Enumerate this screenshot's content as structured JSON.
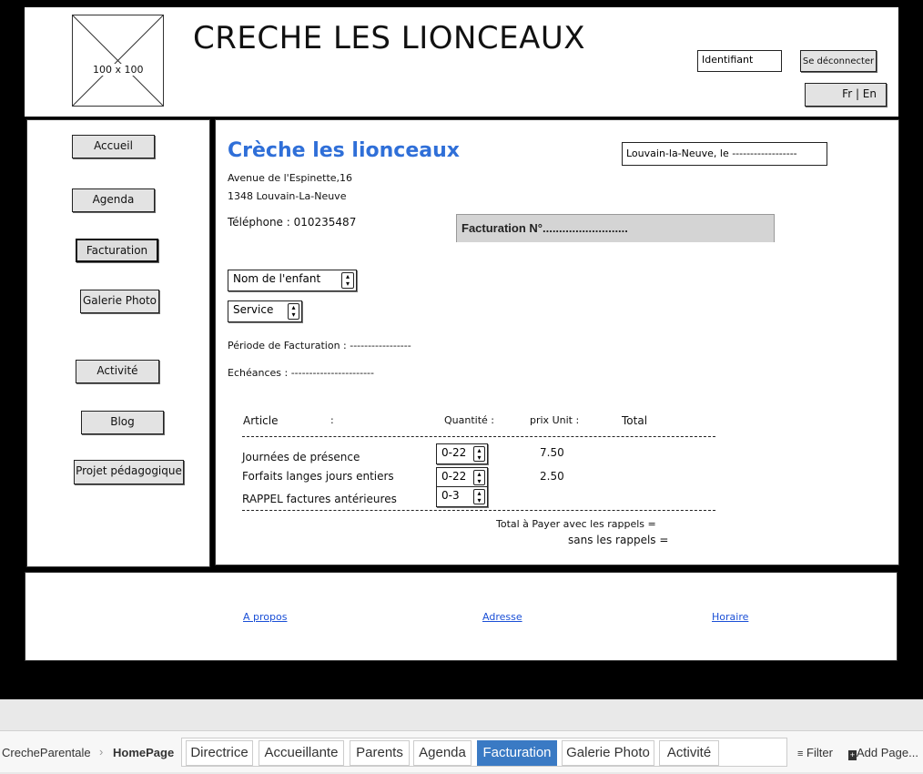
{
  "header": {
    "logo_placeholder": "100 x 100",
    "title": "CRECHE LES LIONCEAUX",
    "login_field": "Identifiant",
    "logout_button": "Se déconnecter",
    "lang_button": "Fr | En"
  },
  "sidebar": {
    "items": [
      {
        "label": "Accueil"
      },
      {
        "label": "Agenda"
      },
      {
        "label": "Facturation"
      },
      {
        "label": "Galerie Photo"
      },
      {
        "label": "Activité"
      },
      {
        "label": "Blog"
      },
      {
        "label": "Projet pédagogique"
      }
    ]
  },
  "invoice": {
    "org_name": "Crèche les lionceaux",
    "address_line1": "Avenue de l'Espinette,16",
    "address_line2": "1348 Louvain-La-Neuve",
    "phone": "Téléphone : 010235487",
    "place_date": "Louvain-la-Neuve, le ------------------",
    "invoice_number": "Facturation N°..........................",
    "child_select": "Nom de l'enfant",
    "service_select": "Service",
    "period": "Période de Facturation : -----------------",
    "due_dates": "Echéances : -----------------------",
    "columns": {
      "article": "Article",
      "colon": ":",
      "quantity": "Quantité :",
      "unit_price": "prix Unit :",
      "total": "Total"
    },
    "rows": [
      {
        "article": "Journées de présence",
        "qty": "0-22",
        "price": "7.50"
      },
      {
        "article": "Forfaits langes jours entiers",
        "qty": "0-22",
        "price": "2.50"
      },
      {
        "article": "RAPPEL factures antérieures",
        "qty": "0-3",
        "price": ""
      }
    ],
    "total_with": "Total à Payer avec les rappels =",
    "total_without": "sans les rappels ="
  },
  "footer": {
    "links": [
      "A propos",
      "Adresse",
      "Horaire"
    ]
  },
  "bottom_bar": {
    "breadcrumb_root": "CrecheParentale",
    "breadcrumb_sep": "›",
    "breadcrumb_current": "HomePage",
    "tabs": [
      "Directrice",
      "Accueillante",
      "Parents",
      "Agenda",
      "Facturation",
      "Galerie Photo",
      "Activité"
    ],
    "selected_tab": "Facturation",
    "filter": "Filter",
    "add_page": "Add Page..."
  },
  "colors": {
    "accent_blue": "#2f6fd8",
    "tab_selected": "#3a7ac4"
  }
}
